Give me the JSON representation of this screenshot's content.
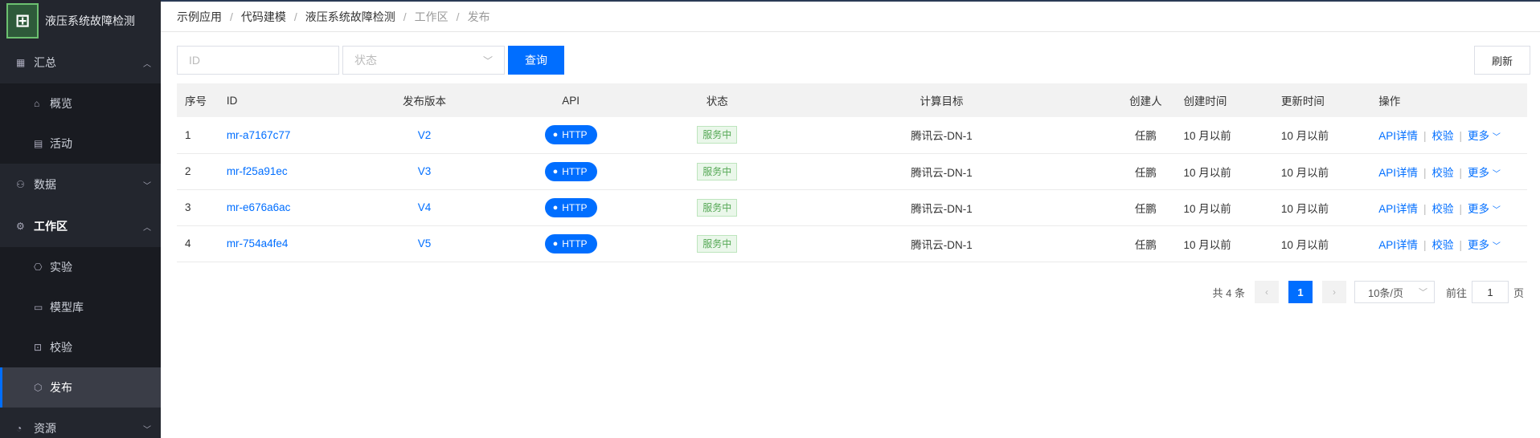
{
  "app": {
    "title": "液压系统故障检测",
    "logo_icon": "grid-logo-icon"
  },
  "sidebar": {
    "groups": [
      {
        "label": "汇总",
        "icon": "dashboard-icon",
        "expanded": true,
        "items": [
          {
            "label": "概览",
            "icon": "home-icon"
          },
          {
            "label": "活动",
            "icon": "calendar-icon"
          }
        ]
      },
      {
        "label": "数据",
        "icon": "sitemap-icon",
        "expanded": false,
        "items": []
      },
      {
        "label": "工作区",
        "icon": "gear-icon",
        "expanded": true,
        "items": [
          {
            "label": "实验",
            "icon": "experiment-icon"
          },
          {
            "label": "模型库",
            "icon": "model-icon"
          },
          {
            "label": "校验",
            "icon": "scan-icon"
          },
          {
            "label": "发布",
            "icon": "package-icon",
            "selected": true
          }
        ]
      },
      {
        "label": "资源",
        "icon": "resource-icon",
        "expanded": false,
        "items": []
      }
    ]
  },
  "breadcrumb": [
    "示例应用",
    "代码建模",
    "液压系统故障检测",
    "工作区",
    "发布"
  ],
  "toolbar": {
    "id_placeholder": "ID",
    "status_placeholder": "状态",
    "query_label": "查询",
    "refresh_label": "刷新"
  },
  "table": {
    "headers": [
      "序号",
      "ID",
      "发布版本",
      "API",
      "状态",
      "计算目标",
      "创建人",
      "创建时间",
      "更新时间",
      "操作"
    ],
    "rows": [
      {
        "no": "1",
        "id": "mr-a7167c77",
        "version": "V2",
        "api": "HTTP",
        "status": "服务中",
        "target": "腾讯云-DN-1",
        "creator": "任鹏",
        "created": "10 月以前",
        "updated": "10 月以前"
      },
      {
        "no": "2",
        "id": "mr-f25a91ec",
        "version": "V3",
        "api": "HTTP",
        "status": "服务中",
        "target": "腾讯云-DN-1",
        "creator": "任鹏",
        "created": "10 月以前",
        "updated": "10 月以前"
      },
      {
        "no": "3",
        "id": "mr-e676a6ac",
        "version": "V4",
        "api": "HTTP",
        "status": "服务中",
        "target": "腾讯云-DN-1",
        "creator": "任鹏",
        "created": "10 月以前",
        "updated": "10 月以前"
      },
      {
        "no": "4",
        "id": "mr-754a4fe4",
        "version": "V5",
        "api": "HTTP",
        "status": "服务中",
        "target": "腾讯云-DN-1",
        "creator": "任鹏",
        "created": "10 月以前",
        "updated": "10 月以前"
      }
    ],
    "ops": {
      "api_detail": "API详情",
      "verify": "校验",
      "more": "更多"
    }
  },
  "pagination": {
    "total_text": "共 4 条",
    "current_page": "1",
    "page_size": "10条/页",
    "goto_label": "前往",
    "goto_value": "1",
    "goto_unit": "页"
  },
  "colors": {
    "primary": "#006eff",
    "sidebar_bg": "#23262e",
    "status_green": "#55a855"
  }
}
